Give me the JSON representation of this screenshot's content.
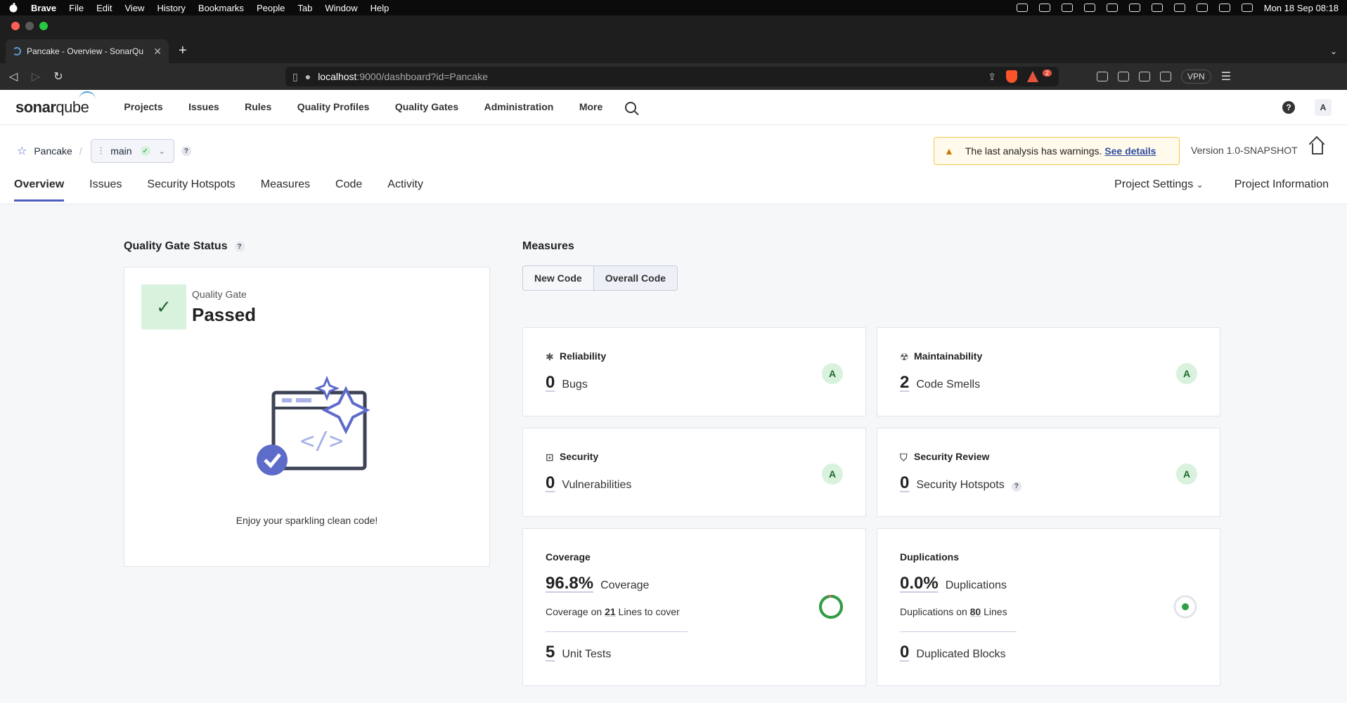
{
  "menubar": {
    "app": "Brave",
    "items": [
      "File",
      "Edit",
      "View",
      "History",
      "Bookmarks",
      "People",
      "Tab",
      "Window",
      "Help"
    ],
    "clock": "Mon 18 Sep  08:18"
  },
  "browser": {
    "tab_title": "Pancake - Overview - SonarQu",
    "url_host": "localhost",
    "url_rest": ":9000/dashboard?id=Pancake",
    "rewards_badge": "2",
    "vpn_label": "VPN"
  },
  "header": {
    "logo_bold": "sonar",
    "logo_light": "qube",
    "nav": [
      "Projects",
      "Issues",
      "Rules",
      "Quality Profiles",
      "Quality Gates",
      "Administration",
      "More"
    ],
    "help_glyph": "?",
    "avatar_letter": "A"
  },
  "project": {
    "name": "Pancake",
    "branch": "main",
    "warning_text": "The last analysis has warnings.",
    "warning_link": "See details",
    "version": "Version 1.0-SNAPSHOT",
    "tabs": [
      "Overview",
      "Issues",
      "Security Hotspots",
      "Measures",
      "Code",
      "Activity"
    ],
    "settings": "Project Settings",
    "information": "Project Information"
  },
  "quality_gate": {
    "section_title": "Quality Gate Status",
    "label": "Quality Gate",
    "status": "Passed",
    "message": "Enjoy your sparkling clean code!"
  },
  "measures": {
    "section_title": "Measures",
    "toggle_new": "New Code",
    "toggle_overall": "Overall Code",
    "reliability": {
      "title": "Reliability",
      "value": "0",
      "unit": "Bugs",
      "rating": "A"
    },
    "maintainability": {
      "title": "Maintainability",
      "value": "2",
      "unit": "Code Smells",
      "rating": "A"
    },
    "security": {
      "title": "Security",
      "value": "0",
      "unit": "Vulnerabilities",
      "rating": "A"
    },
    "security_review": {
      "title": "Security Review",
      "value": "0",
      "unit": "Security Hotspots",
      "rating": "A"
    },
    "coverage": {
      "title": "Coverage",
      "value": "96.8%",
      "unit": "Coverage",
      "sub_prefix": "Coverage on",
      "sub_num": "21",
      "sub_suffix": "Lines to cover",
      "tests_value": "5",
      "tests_unit": "Unit Tests",
      "fraction": 0.968
    },
    "duplications": {
      "title": "Duplications",
      "value": "0.0%",
      "unit": "Duplications",
      "sub_prefix": "Duplications on",
      "sub_num": "80",
      "sub_suffix": "Lines",
      "blocks_value": "0",
      "blocks_unit": "Duplicated Blocks"
    }
  },
  "colors": {
    "accent": "#4b5fc0",
    "passed_bg": "#d9f2de",
    "rating_a": "#1e6b2e",
    "warning_bg": "#fffaeb"
  }
}
